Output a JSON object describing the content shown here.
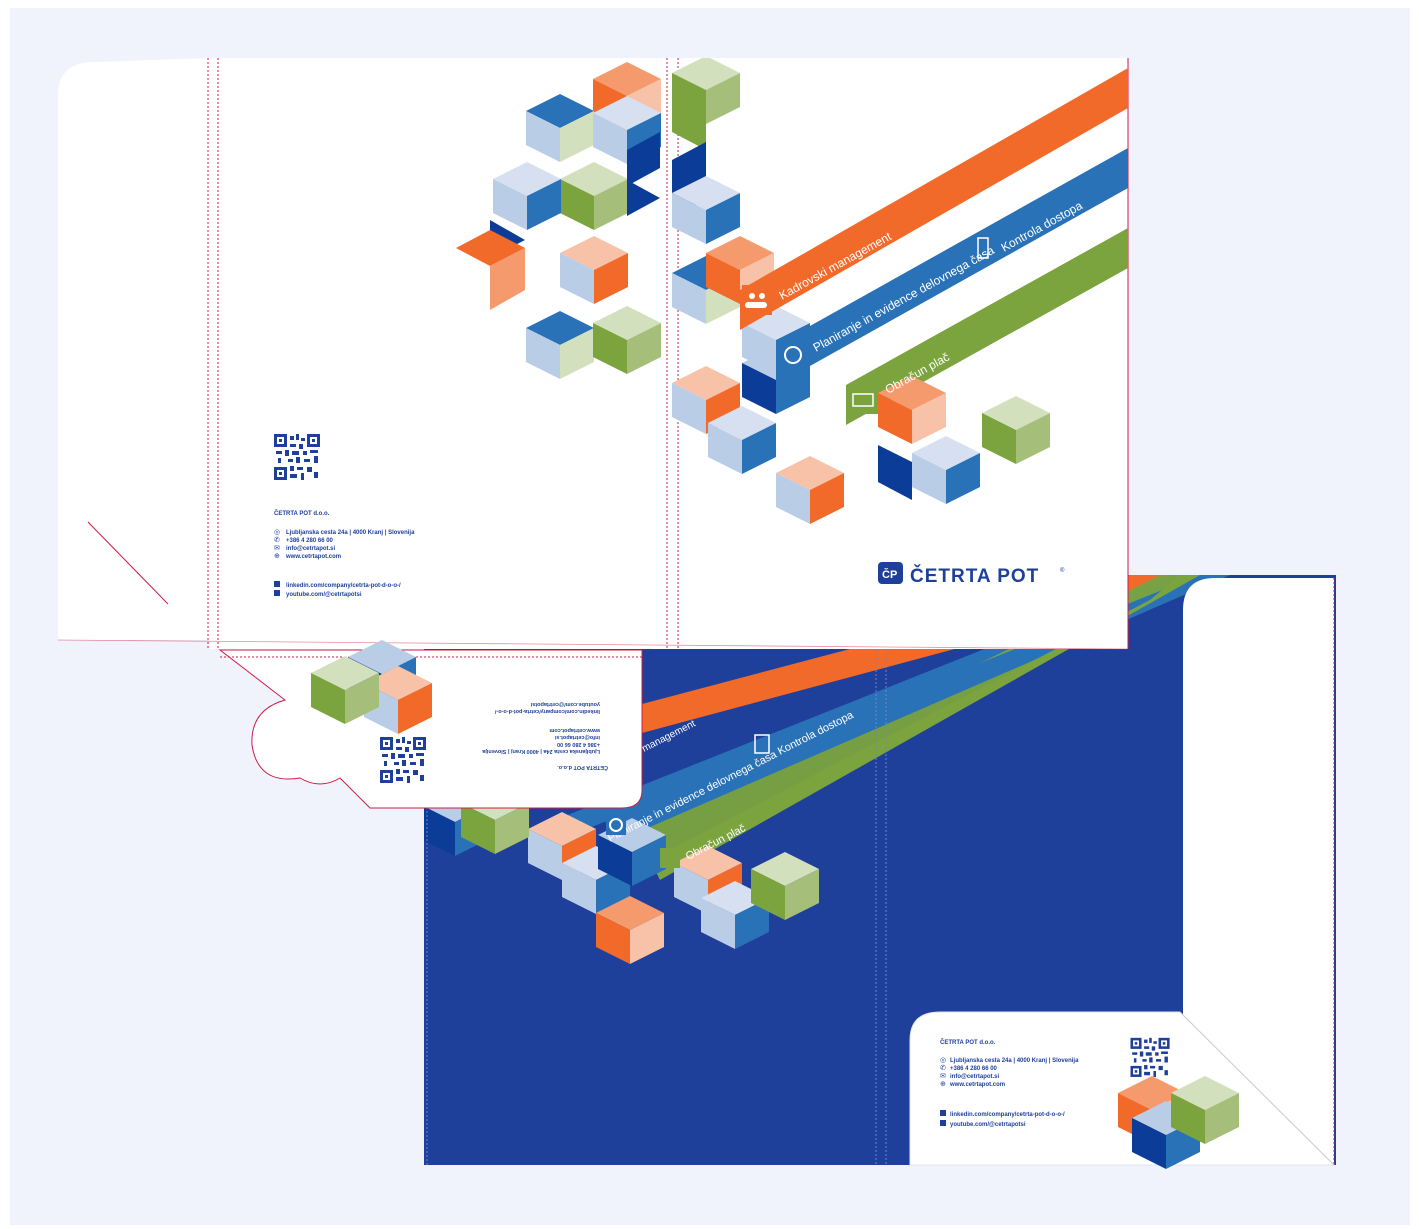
{
  "colors": {
    "background": "#f0f3fb",
    "navy": "#1e3f9a",
    "orange": "#f26a2a",
    "blue": "#2a72b8",
    "green": "#7ba33e",
    "light_blue": "#b9cde6",
    "peach": "#f7c2a8",
    "light_green": "#d3e0bd",
    "dark_blue": "#0b3d98",
    "cut_line": "#d11b45"
  },
  "bands": {
    "kadrovski": "Kadrovski management",
    "planiranje": "Planiranje in evidence delovnega časa",
    "kontrola": "Kontrola dostopa",
    "obracun": "Obračun plač"
  },
  "company": {
    "name": "ČETRTA POT d.o.o.",
    "address": "Ljubljanska cesta 24a | 4000 Kranj | Slovenija",
    "phone": "+386 4 280 66 00",
    "email": "info@cetrtapot.si",
    "web": "www.cetrtapot.com",
    "linkedin": "linkedin.com/company/cetrta-pot-d-o-o-/",
    "youtube": "youtube.com/@cetrtapotsi"
  },
  "logo": {
    "mark": "ČP",
    "wordmark": "ČETRTA POT",
    "registered": "®"
  },
  "icons": [
    "location-pin-icon",
    "phone-icon",
    "mail-icon",
    "globe-icon",
    "linkedin-icon",
    "youtube-icon",
    "people-icon",
    "clock-icon",
    "door-icon",
    "money-icon",
    "qr-code-icon"
  ]
}
